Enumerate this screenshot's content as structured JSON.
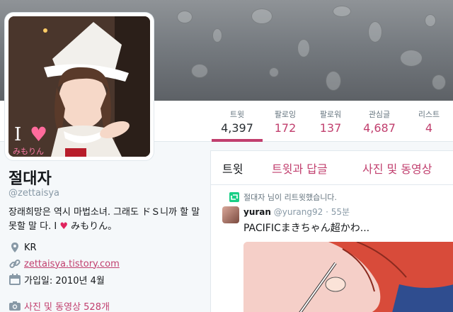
{
  "nav": {
    "stats": [
      {
        "label": "트윗",
        "value": "4,397",
        "active": true
      },
      {
        "label": "팔로잉",
        "value": "172"
      },
      {
        "label": "팔로워",
        "value": "137"
      },
      {
        "label": "관심글",
        "value": "4,687"
      },
      {
        "label": "리스트",
        "value": "4"
      }
    ]
  },
  "profile": {
    "avatar_caption": "みもりん",
    "avatar_letter": "I",
    "name": "절대자",
    "screen_name": "@zettaisya",
    "bio": "장래희망은 역시 마법소녀. 그래도 ドＳ니까 할 말 못할 말 다. I ♥ みもりん。",
    "location": "KR",
    "url": "zettaisya.tistory.com",
    "joined": "가입일: 2010년 4월",
    "media_link": "사진 및 동영상 528개"
  },
  "timeline": {
    "tabs": [
      "트윗",
      "트윗과 답글",
      "사진 및 동영상"
    ],
    "retweet_context": "절대자 님이 리트윗했습니다.",
    "tweet": {
      "author": "yuran",
      "handle": "@yurang92",
      "time": "· 55분",
      "text": "PACIFICまきちゃん超かわ..."
    }
  },
  "colors": {
    "accent": "#c13f6e",
    "retweet": "#19cf86"
  }
}
